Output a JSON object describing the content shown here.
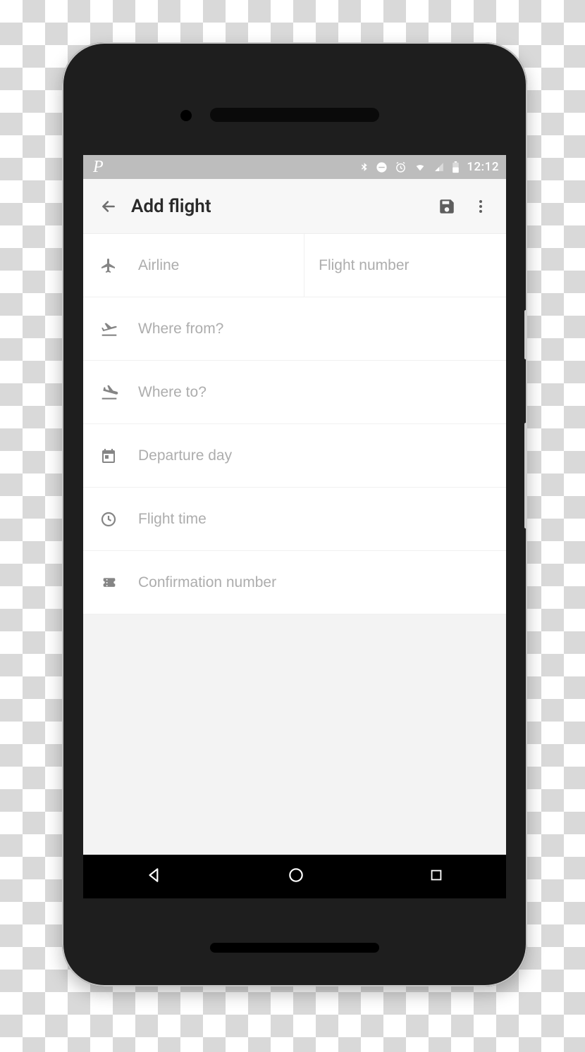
{
  "status": {
    "carrier_glyph": "P",
    "clock": "12:12"
  },
  "appbar": {
    "title": "Add flight"
  },
  "form": {
    "airline_placeholder": "Airline",
    "flight_number_placeholder": "Flight number",
    "from_placeholder": "Where from?",
    "to_placeholder": "Where to?",
    "departure_placeholder": "Departure day",
    "time_placeholder": "Flight time",
    "confirmation_placeholder": "Confirmation number"
  }
}
